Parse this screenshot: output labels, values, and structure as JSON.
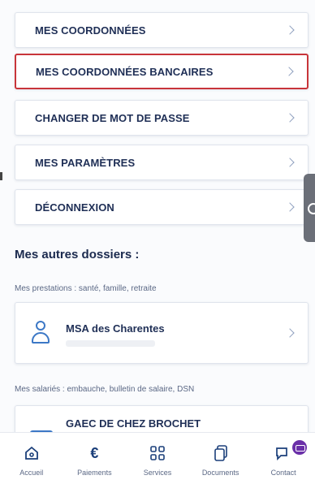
{
  "menu": {
    "items": [
      {
        "label": "MES COORDONNÉES"
      },
      {
        "label": "MES COORDONNÉES BANCAIRES"
      },
      {
        "label": "CHANGER DE MOT DE PASSE"
      },
      {
        "label": "MES PARAMÈTRES"
      },
      {
        "label": "DÉCONNEXION"
      }
    ]
  },
  "other_folders": {
    "title": "Mes autres dossiers :",
    "groups": [
      {
        "caption": "Mes prestations : santé, famille, retraite",
        "folder_name": "MSA des Charentes"
      },
      {
        "caption": "Mes salariés : embauche, bulletin de salaire, DSN",
        "folder_name": "GAEC DE CHEZ BROCHET"
      }
    ]
  },
  "bottom_nav": {
    "items": [
      {
        "label": "Accueil",
        "icon": "home-icon"
      },
      {
        "label": "Paiements",
        "icon": "euro-icon"
      },
      {
        "label": "Services",
        "icon": "grid-icon"
      },
      {
        "label": "Documents",
        "icon": "document-icon"
      },
      {
        "label": "Contact",
        "icon": "chat-icon"
      }
    ]
  },
  "colors": {
    "selected_border": "#c8353a",
    "primary": "#1f2f56",
    "accent_blue": "#3c78c6",
    "badge": "#6a2fa8"
  }
}
